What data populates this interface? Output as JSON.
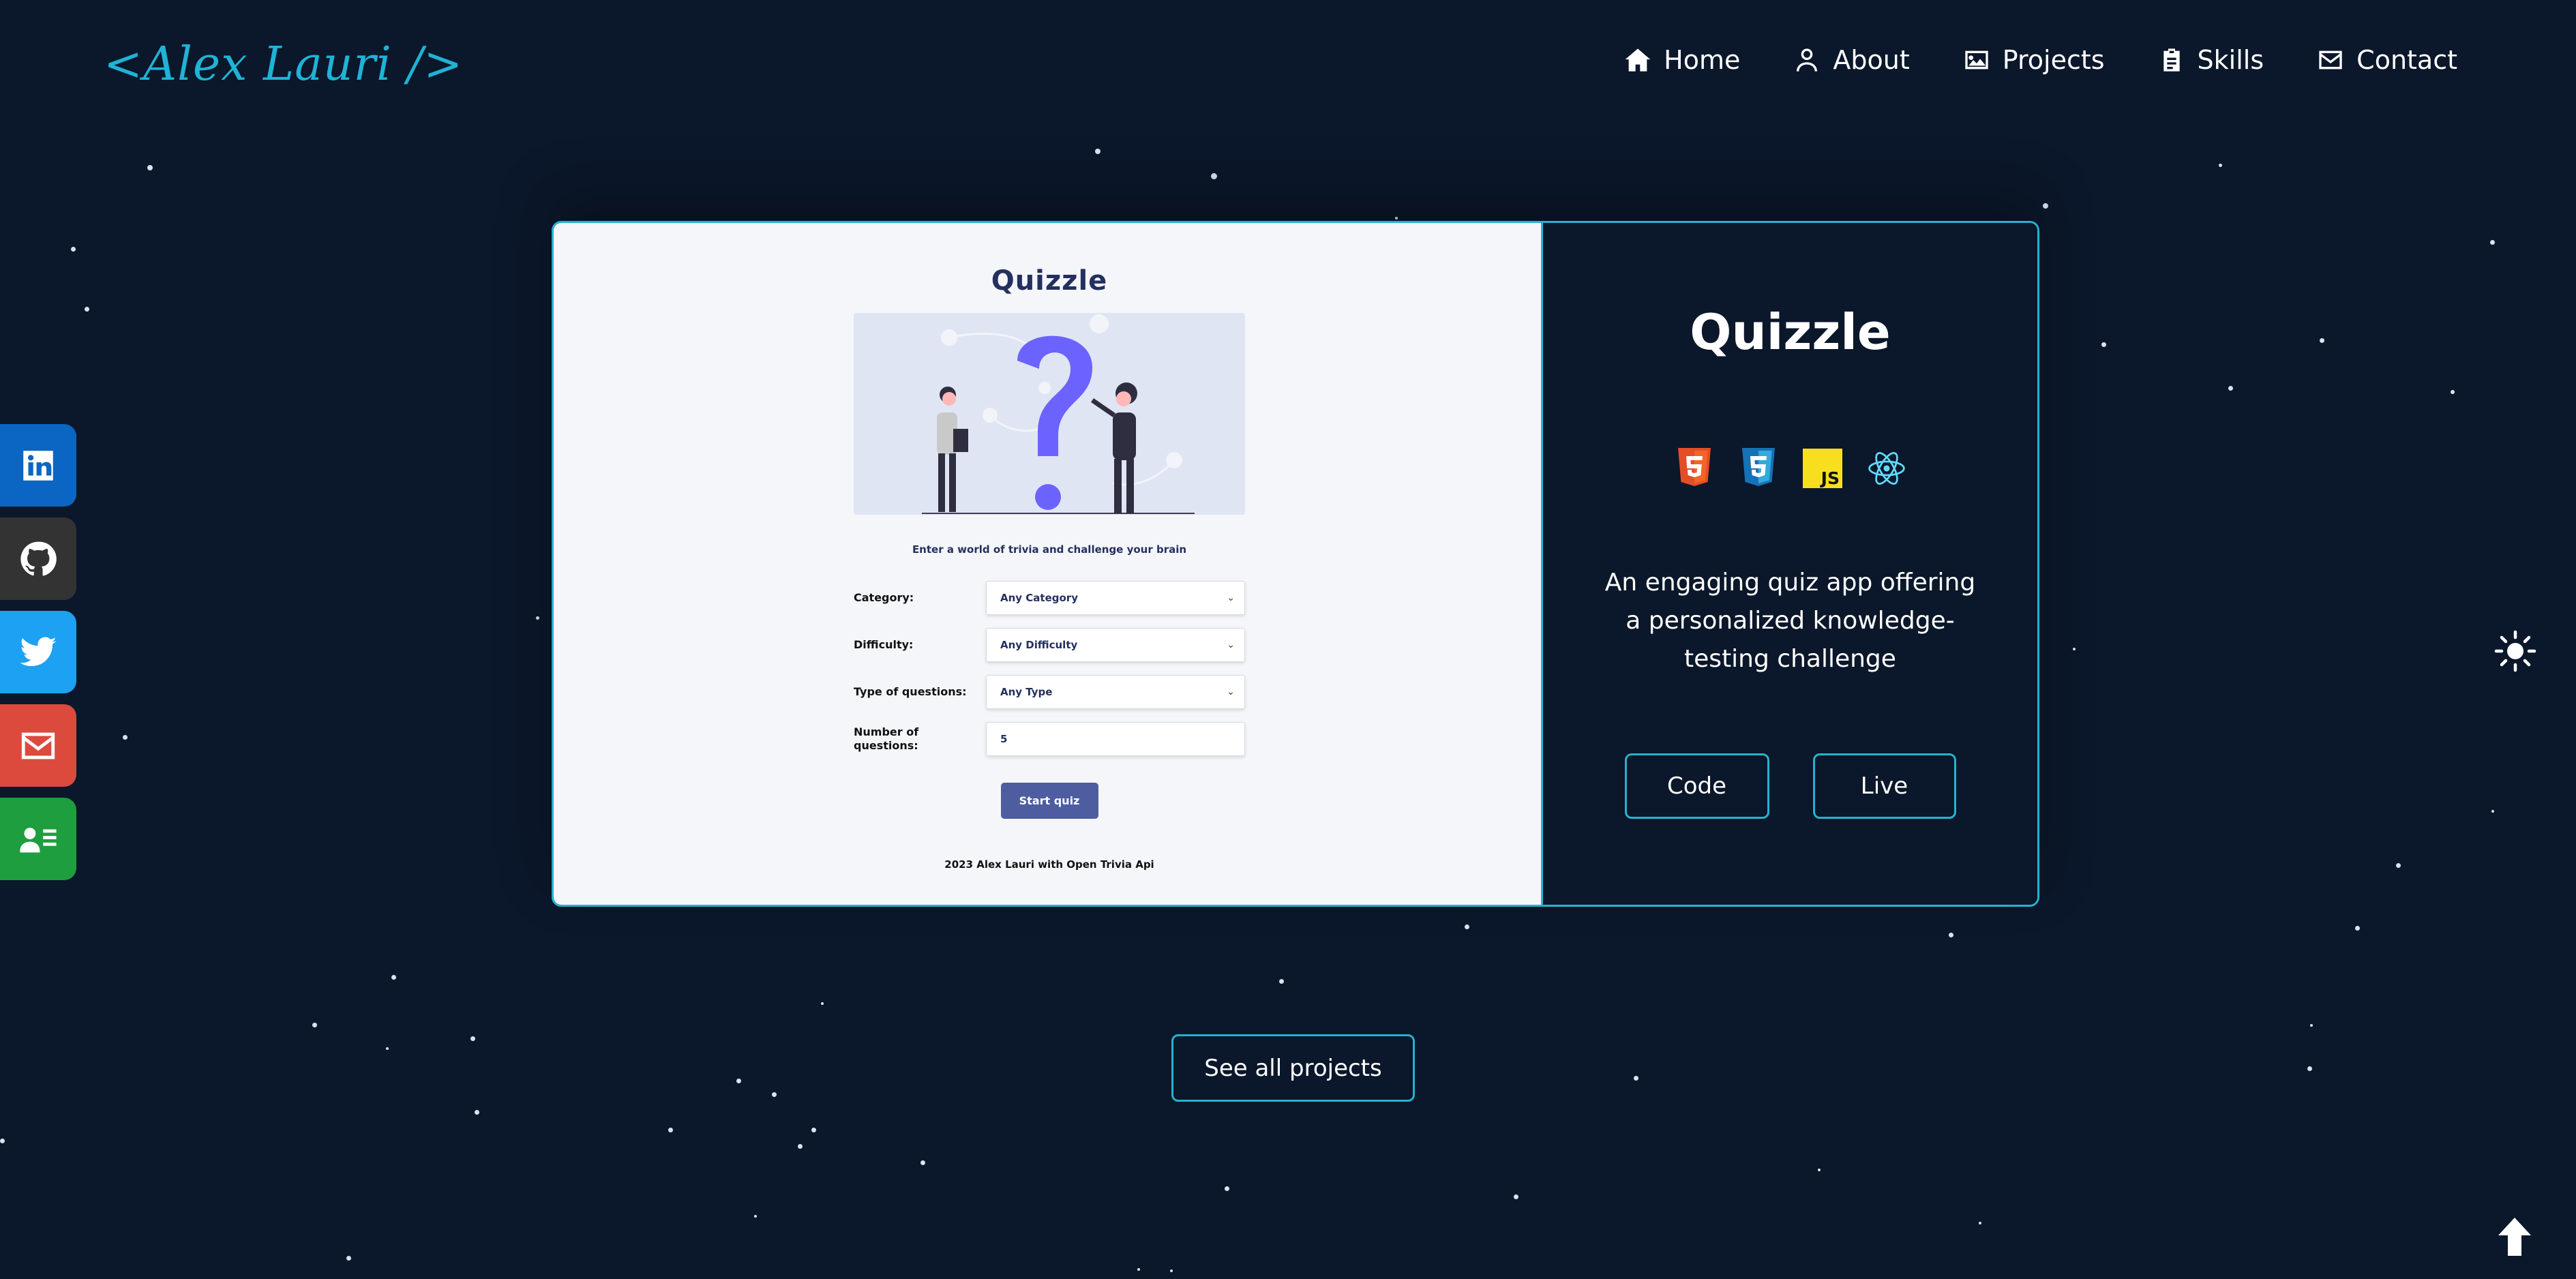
{
  "header": {
    "logo": "<Alex Lauri />",
    "nav": [
      {
        "label": "Home",
        "icon": "home-icon"
      },
      {
        "label": "About",
        "icon": "user-icon"
      },
      {
        "label": "Projects",
        "icon": "image-icon"
      },
      {
        "label": "Skills",
        "icon": "clipboard-icon"
      },
      {
        "label": "Contact",
        "icon": "envelope-icon"
      }
    ]
  },
  "social": [
    {
      "name": "linkedin-icon",
      "color": "#0a66c2"
    },
    {
      "name": "github-icon",
      "color": "#333333"
    },
    {
      "name": "twitter-icon",
      "color": "#1da1f2"
    },
    {
      "name": "mail-icon",
      "color": "#dc4a3d"
    },
    {
      "name": "resume-icon",
      "color": "#1e9e3e"
    }
  ],
  "project": {
    "preview": {
      "title": "Quizzle",
      "subtitle": "Enter a world of trivia and challenge your brain",
      "fields": [
        {
          "label": "Category:",
          "value": "Any Category"
        },
        {
          "label": "Difficulty:",
          "value": "Any Difficulty"
        },
        {
          "label": "Type of questions:",
          "value": "Any Type"
        },
        {
          "label": "Number of questions:",
          "value": "5"
        }
      ],
      "start_label": "Start quiz",
      "footer": "2023 Alex Lauri with Open Trivia Api"
    },
    "title": "Quizzle",
    "tech": [
      "html5-icon",
      "css3-icon",
      "javascript-icon",
      "react-icon"
    ],
    "description": "An engaging quiz app offering a personalized knowledge-testing challenge",
    "code_label": "Code",
    "live_label": "Live"
  },
  "see_all_label": "See all projects",
  "colors": {
    "accent": "#26b2cf",
    "background": "#0b172a",
    "logo": "#1fb3d6"
  }
}
